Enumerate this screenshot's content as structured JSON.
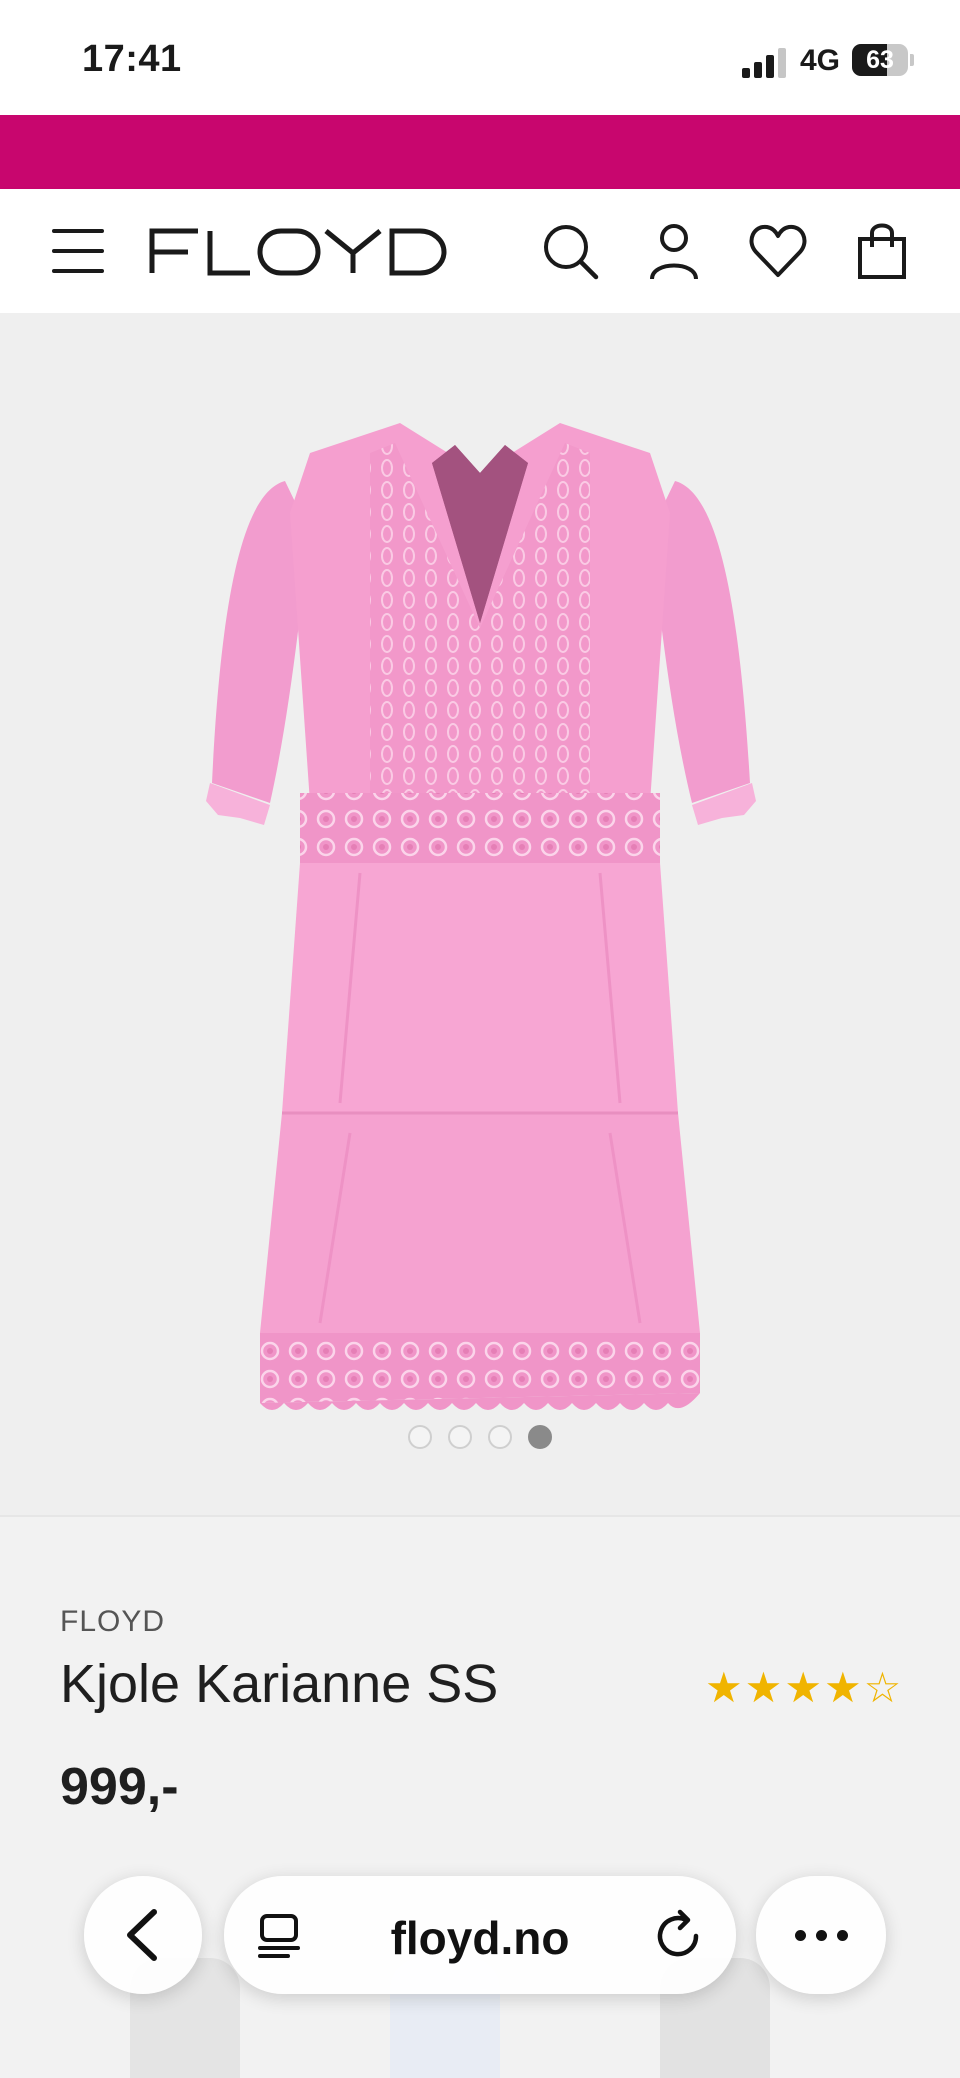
{
  "status_bar": {
    "time": "17:41",
    "network": "4G",
    "battery": "63",
    "battery_level": 0.63,
    "signal_bars": 3
  },
  "colors": {
    "promo_band": "#c8066e",
    "dress_pink": "#f28ec4",
    "star": "#f0b400"
  },
  "header": {
    "logo_text": "FLOYD",
    "icons": [
      "menu-icon",
      "search-icon",
      "account-icon",
      "wishlist-heart-icon",
      "shopping-bag-icon"
    ]
  },
  "gallery": {
    "image": "pink-dress-product-photo",
    "slides": 4,
    "active_slide": 4
  },
  "product": {
    "brand": "FLOYD",
    "name": "Kjole Karianne SS",
    "price": "999,-",
    "rating": 4,
    "rating_max": 5
  },
  "browser": {
    "url": "floyd.no",
    "icons": [
      "back-chevron-icon",
      "tabs-icon",
      "reload-icon",
      "more-icon"
    ]
  }
}
